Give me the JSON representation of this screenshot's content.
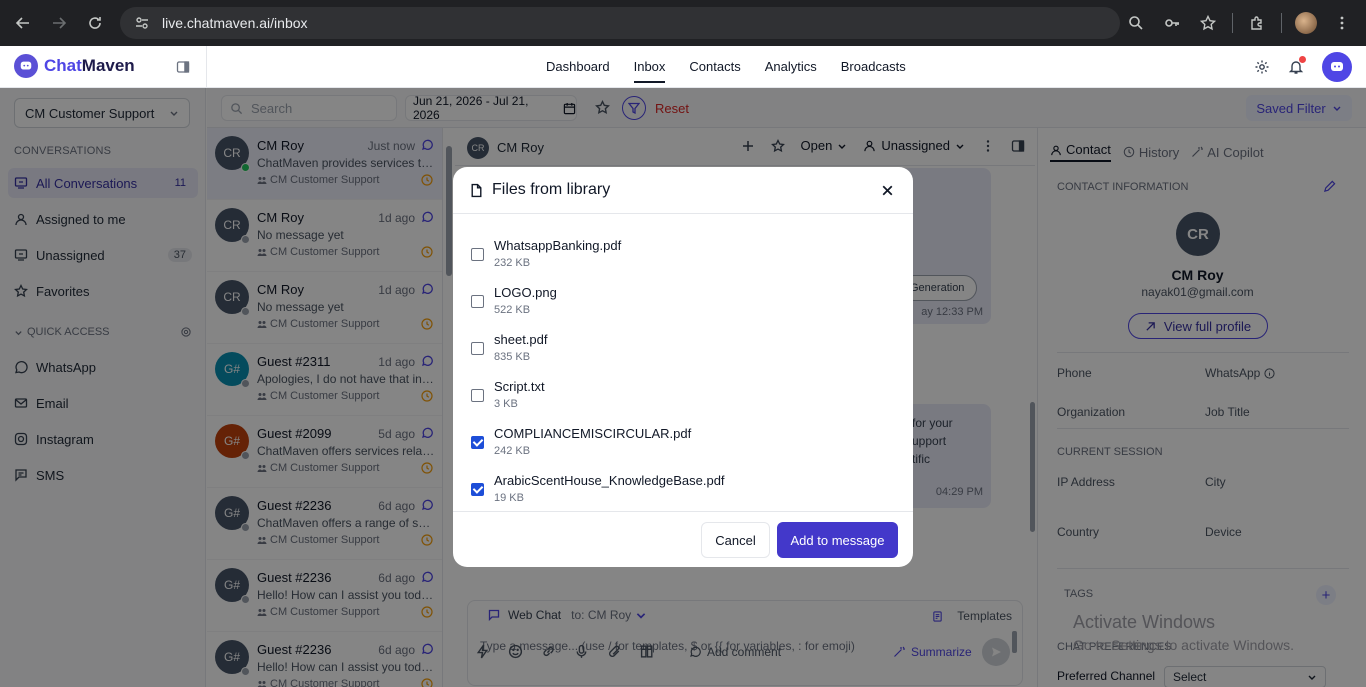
{
  "browser": {
    "url": "live.chatmaven.ai/inbox"
  },
  "brand": {
    "prefix": "Chat",
    "suffix": "Maven"
  },
  "nav": {
    "items": [
      {
        "label": "Dashboard"
      },
      {
        "label": "Inbox"
      },
      {
        "label": "Contacts"
      },
      {
        "label": "Analytics"
      },
      {
        "label": "Broadcasts"
      }
    ],
    "active": "Inbox"
  },
  "sidebar": {
    "team": "CM Customer Support",
    "conversations_label": "CONVERSATIONS",
    "items": [
      {
        "label": "All Conversations",
        "count": "11"
      },
      {
        "label": "Assigned to me",
        "count": ""
      },
      {
        "label": "Unassigned",
        "count": "37"
      },
      {
        "label": "Favorites",
        "count": ""
      }
    ],
    "quick_access_label": "QUICK ACCESS",
    "channels": [
      {
        "label": "WhatsApp"
      },
      {
        "label": "Email"
      },
      {
        "label": "Instagram"
      },
      {
        "label": "SMS"
      }
    ]
  },
  "filters": {
    "search_placeholder": "Search",
    "date_range": "Jun 21, 2026 - Jul 21, 2026",
    "reset": "Reset",
    "saved_filter": "Saved Filter"
  },
  "conversations": [
    {
      "initials": "CR",
      "name": "CM Roy",
      "time": "Just now",
      "preview": "ChatMaven provides services th...",
      "team": "CM Customer Support",
      "avatar_color": "#475569",
      "online": true
    },
    {
      "initials": "CR",
      "name": "CM Roy",
      "time": "1d ago",
      "preview": "No message yet",
      "team": "CM Customer Support",
      "avatar_color": "#475569",
      "online": false
    },
    {
      "initials": "CR",
      "name": "CM Roy",
      "time": "1d ago",
      "preview": "No message yet",
      "team": "CM Customer Support",
      "avatar_color": "#475569",
      "online": false
    },
    {
      "initials": "G#",
      "name": "Guest #2311",
      "time": "1d ago",
      "preview": "Apologies, I do not have that inf...",
      "team": "CM Customer Support",
      "avatar_color": "#0891b2",
      "online": false
    },
    {
      "initials": "G#",
      "name": "Guest #2099",
      "time": "5d ago",
      "preview": "ChatMaven offers services relat...",
      "team": "CM Customer Support",
      "avatar_color": "#c2410c",
      "online": false
    },
    {
      "initials": "G#",
      "name": "Guest #2236",
      "time": "6d ago",
      "preview": "ChatMaven offers a range of ser...",
      "team": "CM Customer Support",
      "avatar_color": "#475569",
      "online": false
    },
    {
      "initials": "G#",
      "name": "Guest #2236",
      "time": "6d ago",
      "preview": "Hello! How can I assist you toda...",
      "team": "CM Customer Support",
      "avatar_color": "#475569",
      "online": false
    },
    {
      "initials": "G#",
      "name": "Guest #2236",
      "time": "6d ago",
      "preview": "Hello! How can I assist you toda...",
      "team": "CM Customer Support",
      "avatar_color": "#475569",
      "online": false
    }
  ],
  "chat": {
    "initials": "CR",
    "name": "CM Roy",
    "status": "Open",
    "assignee": "Unassigned",
    "bubble1_chip": "Generation",
    "bubble1_time": "ay 12:33 PM",
    "bubble2_text": [
      "for your",
      "upport",
      "tific"
    ],
    "bubble2_time": "04:29 PM",
    "channel": "Web Chat",
    "to": "to: CM Roy",
    "templates": "Templates",
    "input_placeholder": "Type a message... (use / for templates, $ or {{ for variables, : for emoji)",
    "add_comment": "Add comment",
    "summarize": "Summarize"
  },
  "contact_panel": {
    "tabs": [
      {
        "label": "Contact"
      },
      {
        "label": "History"
      },
      {
        "label": "AI Copilot"
      }
    ],
    "contact_info_label": "CONTACT INFORMATION",
    "initials": "CR",
    "name": "CM Roy",
    "email": "nayak01@gmail.com",
    "view_profile": "View full profile",
    "phone": "Phone",
    "whatsapp": "WhatsApp",
    "organization": "Organization",
    "job_title": "Job Title",
    "current_session_label": "CURRENT SESSION",
    "ip_address": "IP Address",
    "city": "City",
    "country": "Country",
    "device": "Device",
    "tags_label": "TAGS",
    "chat_prefs_label": "CHAT PREFERENCES",
    "preferred_channel": "Preferred Channel",
    "preferred_channel_value": "Select"
  },
  "watermark": {
    "line1": "Activate Windows",
    "line2": "Go to Settings to activate Windows."
  },
  "modal": {
    "title": "Files from library",
    "files": [
      {
        "name": "WhatsappBanking.pdf",
        "size": "232 KB",
        "checked": false
      },
      {
        "name": "LOGO.png",
        "size": "522 KB",
        "checked": false
      },
      {
        "name": "sheet.pdf",
        "size": "835 KB",
        "checked": false
      },
      {
        "name": "Script.txt",
        "size": "3 KB",
        "checked": false
      },
      {
        "name": "COMPLIANCEMISCIRCULAR.pdf",
        "size": "242 KB",
        "checked": true
      },
      {
        "name": "ArabicScentHouse_KnowledgeBase.pdf",
        "size": "19 KB",
        "checked": true
      }
    ],
    "cancel_label": "Cancel",
    "add_label": "Add to message"
  }
}
